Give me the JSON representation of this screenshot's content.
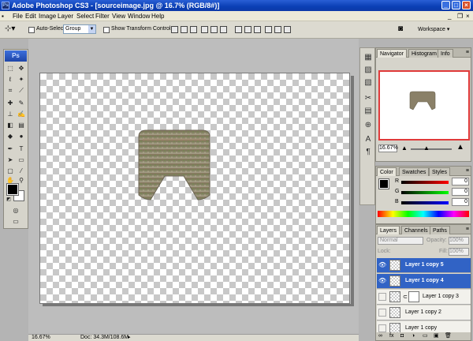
{
  "window": {
    "title": "Adobe Photoshop CS3 - [sourceimage.jpg @ 16.7% (RGB/8#)]",
    "app_badge": "Ps"
  },
  "menu": [
    "File",
    "Edit",
    "Image",
    "Layer",
    "Select",
    "Filter",
    "View",
    "Window",
    "Help"
  ],
  "options": {
    "auto_select_label": "Auto-Select:",
    "auto_select_value": "Group",
    "show_transform_label": "Show Transform Controls",
    "workspace_label": "Workspace ▾"
  },
  "toolbox": {
    "logo": "Ps"
  },
  "status": {
    "zoom": "16.67%",
    "doc_size": "Doc: 34.3M/108.6M"
  },
  "navigator": {
    "tabs": [
      "Navigator",
      "Histogram",
      "Info"
    ],
    "zoom": "16.67%"
  },
  "color": {
    "tabs": [
      "Color",
      "Swatches",
      "Styles"
    ],
    "channels": [
      {
        "label": "R",
        "value": "0"
      },
      {
        "label": "G",
        "value": "0"
      },
      {
        "label": "B",
        "value": "0"
      }
    ]
  },
  "layers": {
    "tabs": [
      "Layers",
      "Channels",
      "Paths"
    ],
    "blend_mode": "Normal",
    "opacity_label": "Opacity:",
    "opacity_value": "100%",
    "lock_label": "Lock:",
    "fill_label": "Fill:",
    "fill_value": "100%",
    "rows": [
      {
        "name": "Layer 1 copy 5",
        "selected": true
      },
      {
        "name": "Layer 1 copy 4",
        "selected": true
      },
      {
        "name": "Layer 1 copy 3",
        "selected": false
      },
      {
        "name": "Layer 1 copy 2",
        "selected": false
      },
      {
        "name": "Layer 1 copy",
        "selected": false
      }
    ]
  },
  "colors": {
    "title_blue": "#0a3fb5",
    "selection_blue": "#3163c5",
    "navigator_red": "#e03a3a"
  }
}
